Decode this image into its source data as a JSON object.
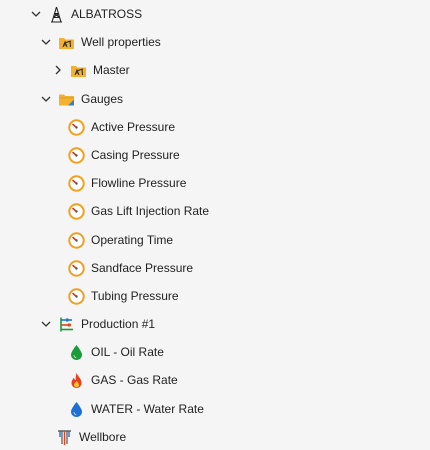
{
  "tree": {
    "root": {
      "label": "ALBATROSS",
      "icon": "oil-derrick-icon",
      "expanded": true
    },
    "well_properties": {
      "label": "Well properties",
      "icon": "folder-with-pumpjack-icon",
      "expanded": true,
      "children": [
        {
          "label": "Master",
          "icon": "folder-with-pumpjack-icon",
          "expanded": false
        }
      ]
    },
    "gauges": {
      "label": "Gauges",
      "icon": "folder-icon",
      "expanded": true,
      "items": [
        {
          "label": "Active Pressure",
          "icon": "gauge-icon"
        },
        {
          "label": "Casing Pressure",
          "icon": "gauge-icon"
        },
        {
          "label": "Flowline Pressure",
          "icon": "gauge-icon"
        },
        {
          "label": "Gas Lift Injection Rate",
          "icon": "gauge-icon"
        },
        {
          "label": "Operating Time",
          "icon": "gauge-icon"
        },
        {
          "label": "Sandface Pressure",
          "icon": "gauge-icon"
        },
        {
          "label": "Tubing Pressure",
          "icon": "gauge-icon"
        }
      ]
    },
    "production": {
      "label": "Production #1",
      "icon": "production-network-icon",
      "expanded": true,
      "items": [
        {
          "label": "OIL - Oil Rate",
          "icon": "oil-drop-icon",
          "color": "#1a9c3a"
        },
        {
          "label": "GAS - Gas Rate",
          "icon": "flame-icon",
          "color": "#e8401c"
        },
        {
          "label": "WATER - Water Rate",
          "icon": "water-drop-icon",
          "color": "#1f6fd1"
        }
      ]
    },
    "wellbore": {
      "label": "Wellbore",
      "icon": "wellbore-icon"
    }
  },
  "colors": {
    "background": "#f5f5f5",
    "text": "#1f1f1f",
    "chevron": "#333333",
    "folder": "#f2b12f",
    "gauge_ring": "#f0a020",
    "gauge_needle": "#d8341c"
  }
}
